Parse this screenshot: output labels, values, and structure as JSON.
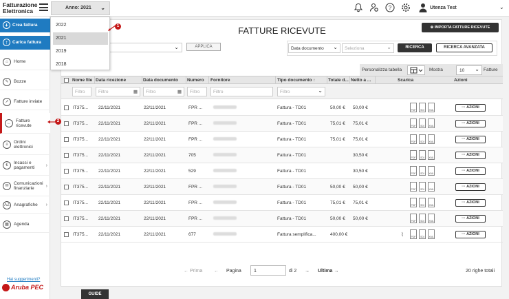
{
  "app": {
    "title_line1": "Fatturazione",
    "title_line2": "Elettronica"
  },
  "topbar": {
    "year_button": "Anno: 2021",
    "user_name": "Utenza Test"
  },
  "year_dropdown": {
    "options": [
      "2022",
      "2021",
      "2019",
      "2018"
    ],
    "selected": "2021"
  },
  "badges": [
    "1",
    "2"
  ],
  "sidebar": {
    "create_invoice": "Crea fattura",
    "upload_invoice": "Carica fattura",
    "items": [
      {
        "label": "Home"
      },
      {
        "label": "Bozze"
      },
      {
        "label": "Fatture inviate"
      },
      {
        "label_line1": "Fatture",
        "label_line2": "ricevute"
      },
      {
        "label_line1": "Ordini",
        "label_line2": "elettronici"
      },
      {
        "label_line1": "Incassi e",
        "label_line2": "pagamenti"
      },
      {
        "label_line1": "Comunicazioni",
        "label_line2": "finanziarie"
      },
      {
        "label": "Anagrafiche"
      },
      {
        "label": "Agenda"
      }
    ],
    "suggestions": "Hai suggerimenti?",
    "brand": "Aruba PEC",
    "guide": "GUIDE"
  },
  "main": {
    "page_title": "FATTURE RICEVUTE",
    "import_button": "IMPORTA FATTURE RICEVUTE",
    "apply_button": "APPLICA",
    "date_filter": "Data documento",
    "select_placeholder": "Seleziona",
    "search_button": "RICERCA",
    "advanced_search_button": "RICERCA AVANZATA",
    "customize_table": "Personalizza tabella",
    "show_label": "Mostra",
    "rows_per_page": "10",
    "invoices_label": "Fatture",
    "columns": [
      "Nome file",
      "Data ricezione",
      "Data documento",
      "Numero",
      "Fornitore",
      "Tipo documento ↑",
      "Totale d...",
      "Netto a ...",
      "Scarica",
      "Azioni"
    ],
    "filter_placeholder": "Filtro",
    "actions_label": "··· AZIONI",
    "download_labels": [
      "PDF",
      "SDI",
      "XML"
    ],
    "rows": [
      {
        "file": "IT375...",
        "ric": "22/11/2021",
        "doc": "22/11/2021",
        "num": "FPR ...",
        "tipo": "Fattura - TD01",
        "tot": "50,00 €",
        "net": "50,00 €"
      },
      {
        "file": "IT375...",
        "ric": "22/11/2021",
        "doc": "22/11/2021",
        "num": "FPR ...",
        "tipo": "Fattura - TD01",
        "tot": "75,01 €",
        "net": "75,01 €"
      },
      {
        "file": "IT375...",
        "ric": "22/11/2021",
        "doc": "22/11/2021",
        "num": "FPR ...",
        "tipo": "Fattura - TD01",
        "tot": "75,01 €",
        "net": "75,01 €"
      },
      {
        "file": "IT375...",
        "ric": "22/11/2021",
        "doc": "22/11/2021",
        "num": "705",
        "tipo": "Fattura - TD01",
        "tot": "",
        "net": "30,50 €"
      },
      {
        "file": "IT375...",
        "ric": "22/11/2021",
        "doc": "22/11/2021",
        "num": "529",
        "tipo": "Fattura - TD01",
        "tot": "",
        "net": "30,50 €"
      },
      {
        "file": "IT375...",
        "ric": "22/11/2021",
        "doc": "22/11/2021",
        "num": "FPR ...",
        "tipo": "Fattura - TD01",
        "tot": "50,00 €",
        "net": "50,00 €"
      },
      {
        "file": "IT375...",
        "ric": "22/11/2021",
        "doc": "22/11/2021",
        "num": "FPR ...",
        "tipo": "Fattura - TD01",
        "tot": "75,01 €",
        "net": "75,01 €"
      },
      {
        "file": "IT375...",
        "ric": "22/11/2021",
        "doc": "22/11/2021",
        "num": "FPR ...",
        "tipo": "Fattura - TD01",
        "tot": "50,00 €",
        "net": "50,00 €"
      },
      {
        "file": "IT375...",
        "ric": "22/11/2021",
        "doc": "22/11/2021",
        "num": "677",
        "tipo": "Fattura semplifica...",
        "tot": "400,00 €",
        "net": ""
      }
    ],
    "pager": {
      "first": "← Prima",
      "prev": "←",
      "page_label": "Pagina",
      "page_value": "1",
      "of": "di 2",
      "next": "→",
      "last": "Ultima →",
      "total": "20 righe totali"
    }
  },
  "colors": {
    "accent": "#1f7bc1",
    "badge": "#c41818",
    "dark_button": "#333333"
  }
}
